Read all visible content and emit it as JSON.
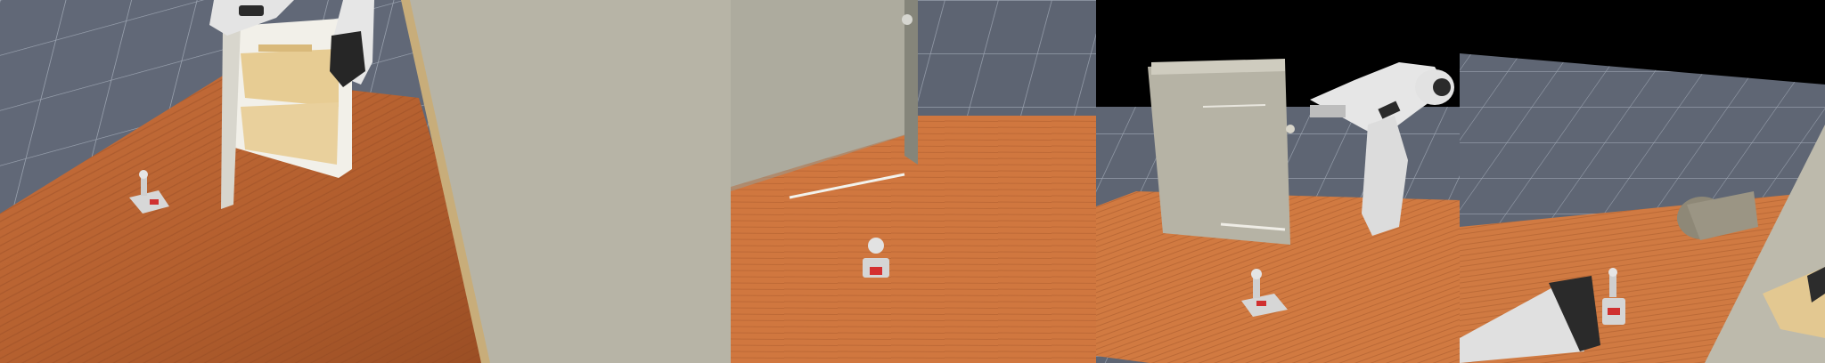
{
  "panels": [
    {
      "name": "camera-view-1",
      "description_key": "perspective-left"
    },
    {
      "name": "camera-view-2",
      "description_key": "front"
    },
    {
      "name": "camera-view-3",
      "description_key": "overview"
    },
    {
      "name": "camera-view-4",
      "description_key": "wrist"
    }
  ],
  "colors": {
    "sky": "#000000",
    "floor": "#5f6673",
    "floor_grid": "#9aa1ad",
    "table_light": "#d98855",
    "table_dark": "#a85a2e",
    "cabinet": "#b9b6a8",
    "cabinet_dark": "#8e8c82",
    "shelf": "#e8cf9a",
    "robot": "#e2e2e2",
    "robot_dark": "#2c2c2c"
  },
  "icons": [
    "robot-arm",
    "cabinet",
    "joystick-object"
  ]
}
